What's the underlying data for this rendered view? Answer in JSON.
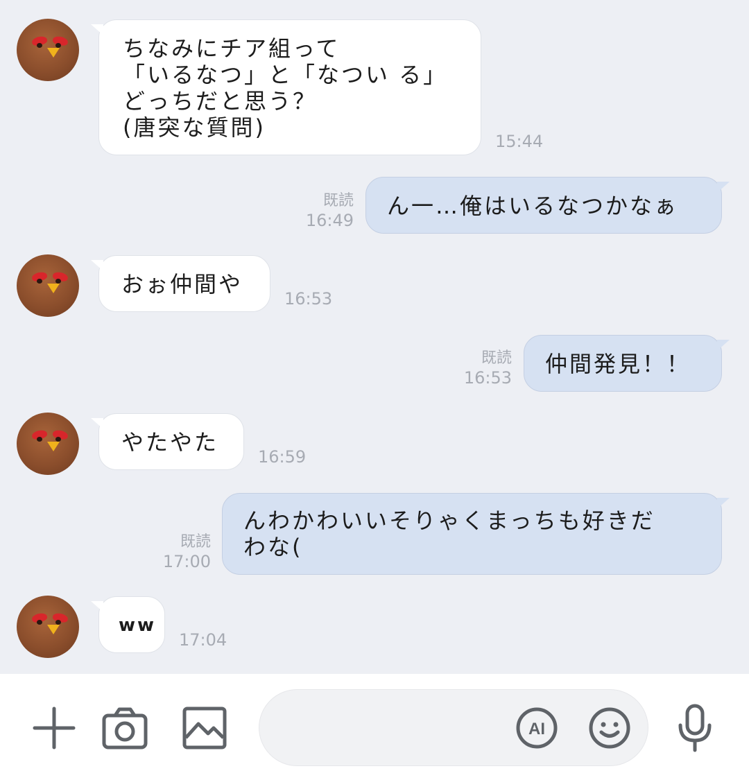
{
  "messages": [
    {
      "dir": "in",
      "text": "ちなみにチア組って\n「いるなつ」と「なつい る」\nどっちだと思う？\n(唐突な質問)",
      "time": "15:44"
    },
    {
      "dir": "out",
      "text": "ん一…俺はいるなつかなぁ",
      "read": "既読",
      "time": "16:49"
    },
    {
      "dir": "in",
      "text": "おぉ仲間や",
      "time": "16:53"
    },
    {
      "dir": "out",
      "text": "仲間発見！！",
      "read": "既読",
      "time": "16:53"
    },
    {
      "dir": "in",
      "text": "やたやた",
      "time": "16:59"
    },
    {
      "dir": "out",
      "text": "んわかわいいそりゃくまっちも好きだ\nわな(",
      "read": "既読",
      "time": "17:00"
    },
    {
      "dir": "in",
      "text": "ww",
      "time": "17:04"
    }
  ],
  "composer": {
    "input_value": "",
    "ai_label": "AI",
    "icons": [
      "plus-icon",
      "camera-icon",
      "image-icon",
      "ai-icon",
      "emoji-icon",
      "mic-icon"
    ]
  },
  "colors": {
    "background": "#edeff4",
    "incoming": "#ffffff",
    "outgoing": "#d6e1f2",
    "meta": "#a7abb3"
  }
}
